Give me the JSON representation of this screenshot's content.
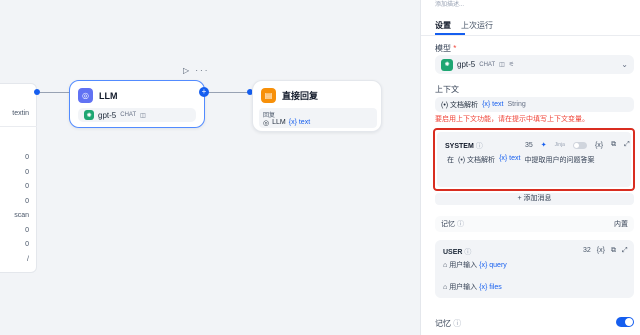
{
  "left_node": {
    "cells": [
      "textin",
      "0",
      "0",
      "0",
      "0",
      "scan",
      "0",
      "0",
      "/"
    ]
  },
  "llm_node": {
    "title": "LLM",
    "model": "gpt-5",
    "model_tag": "CHAT",
    "toolbar": "▷ ···"
  },
  "answer_node": {
    "title": "直接回复",
    "field_label": "回复",
    "field_source": "LLM",
    "field_var": "{x} text"
  },
  "panel": {
    "faint_top": "添加描述...",
    "tabs": [
      "设置",
      "上次运行"
    ],
    "model_label": "模型",
    "model_required": "*",
    "model_name": "gpt-5",
    "model_tag": "CHAT",
    "context_label": "上下文",
    "context_source": "(•) 文档解析",
    "context_var": "{x} text",
    "context_type": "String",
    "warning": "要启用上下文功能，请在提示中填写上下文变量。",
    "system": {
      "role": "SYSTEM",
      "count": "35",
      "jinja": "Jinja",
      "var_btn": "{x}",
      "text_prefix": "在",
      "text_source": "(•) 文档解析",
      "text_var": "{x} text",
      "text_suffix": "中提取用户的问题答案"
    },
    "add_message": "+ 添加消息",
    "memory_label": "记忆",
    "memory_builtin": "内置",
    "user": {
      "role": "USER",
      "count": "32",
      "var_btn": "{x}",
      "line1_source": "用户输入",
      "line1_var": "{x} query",
      "line2_source": "用户输入",
      "line2_var": "{x} files"
    },
    "memory_toggle_label": "记忆"
  },
  "colors": {
    "accent": "#155eef",
    "danger": "#d92d20",
    "llm_icon": "#6172f3",
    "answer_icon": "#f79009"
  }
}
